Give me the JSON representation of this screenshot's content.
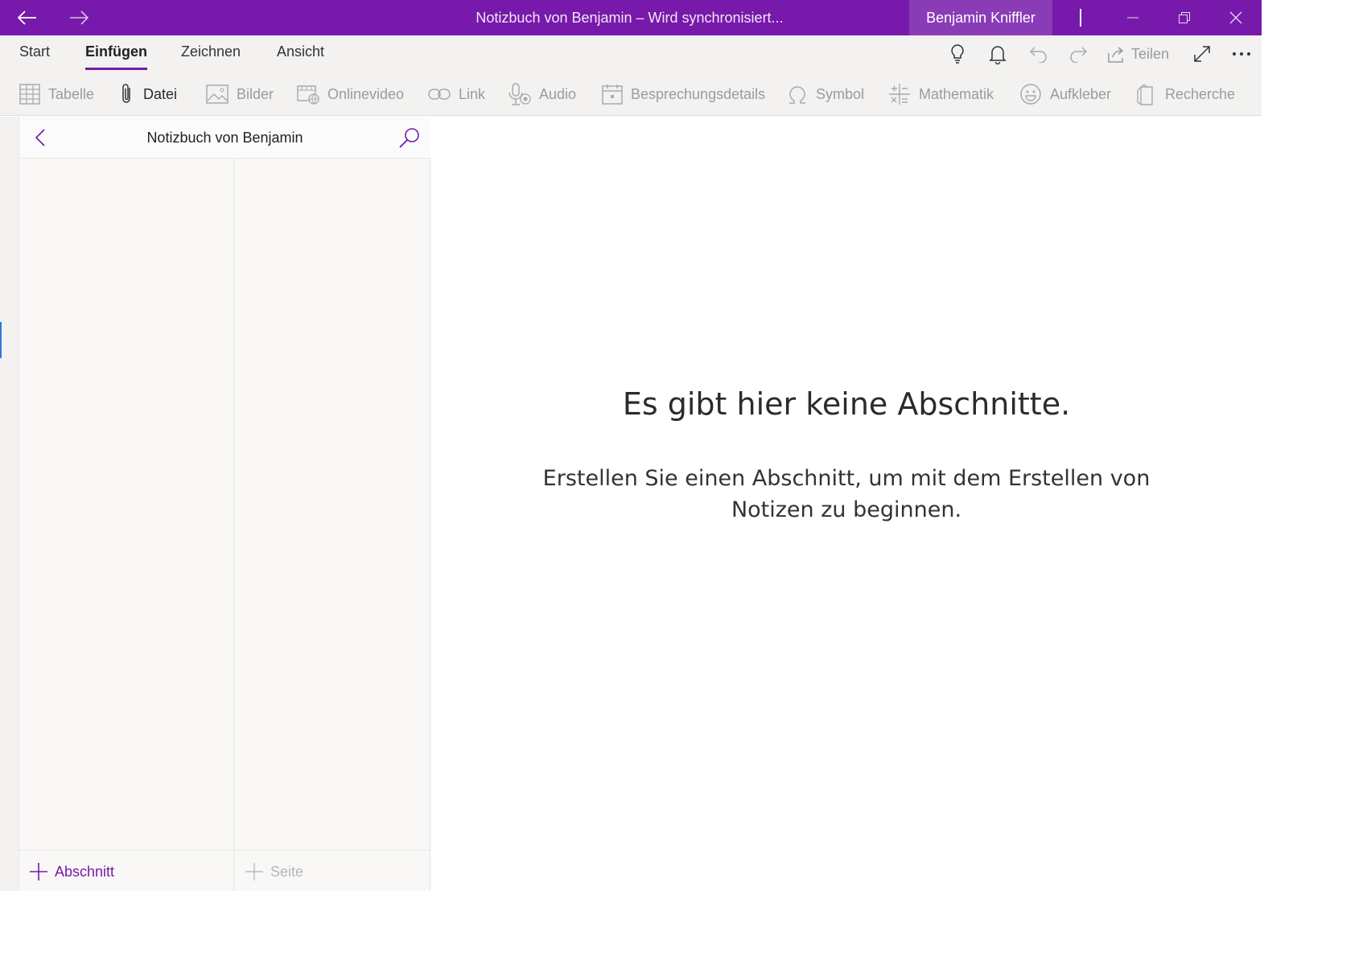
{
  "titlebar": {
    "title": "Notizbuch von Benjamin – Wird synchronisiert...",
    "user": "Benjamin Kniffler",
    "accent": "#7719aa"
  },
  "tabs": [
    {
      "label": "Start",
      "active": false
    },
    {
      "label": "Einfügen",
      "active": true
    },
    {
      "label": "Zeichnen",
      "active": false
    },
    {
      "label": "Ansicht",
      "active": false
    }
  ],
  "toolbar": {
    "share_label": "Teilen"
  },
  "ribbon": [
    {
      "label": "Tabelle",
      "icon": "table-icon",
      "enabled": false
    },
    {
      "label": "Datei",
      "icon": "paperclip-icon",
      "enabled": true
    },
    {
      "label": "Bilder",
      "icon": "picture-icon",
      "enabled": false
    },
    {
      "label": "Onlinevideo",
      "icon": "online-video-icon",
      "enabled": false
    },
    {
      "label": "Link",
      "icon": "link-icon",
      "enabled": false
    },
    {
      "label": "Audio",
      "icon": "microphone-icon",
      "enabled": false
    },
    {
      "label": "Besprechungsdetails",
      "icon": "calendar-icon",
      "enabled": false
    },
    {
      "label": "Symbol",
      "icon": "omega-icon",
      "enabled": false
    },
    {
      "label": "Mathematik",
      "icon": "math-icon",
      "enabled": false
    },
    {
      "label": "Aufkleber",
      "icon": "smiley-icon",
      "enabled": false
    },
    {
      "label": "Recherche",
      "icon": "research-icon",
      "enabled": false
    }
  ],
  "panel": {
    "notebook_name": "Notizbuch von Benjamin",
    "add_section_label": "Abschnitt",
    "add_page_label": "Seite"
  },
  "main": {
    "empty_title": "Es gibt hier keine Abschnitte.",
    "empty_subtitle": "Erstellen Sie einen Abschnitt, um mit dem Erstellen von Notizen zu beginnen."
  }
}
